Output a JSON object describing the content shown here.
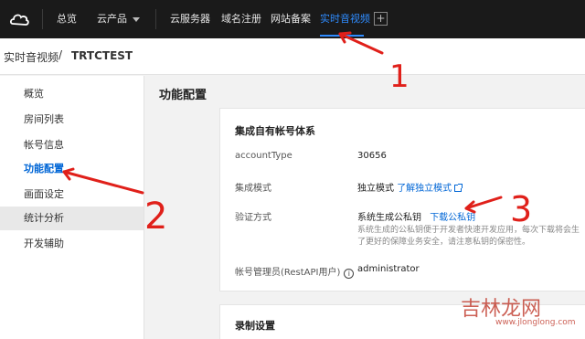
{
  "topbar": {
    "nav": [
      "总览",
      "云产品"
    ],
    "services": [
      "云服务器",
      "域名注册",
      "网站备案",
      "实时音视频"
    ],
    "add_label": "+",
    "active_color": "#2f8cff"
  },
  "breadcrumb": {
    "parent": "实时音视频",
    "separator": "/",
    "current": "TRTCTEST"
  },
  "sidebar": {
    "items": [
      "概览",
      "房间列表",
      "帐号信息",
      "功能配置",
      "画面设定",
      "统计分析",
      "开发辅助"
    ],
    "current_index": 3,
    "hover_index": 5
  },
  "main": {
    "title": "功能配置",
    "card": {
      "title": "集成自有帐号体系",
      "rows": {
        "account_type_label": "accountType",
        "account_type_value": "30656",
        "mode_label": "集成模式",
        "mode_value": "独立模式",
        "mode_link": "了解独立模式",
        "verify_label": "验证方式",
        "verify_value": "系统生成公私钥",
        "verify_link": "下载公私钥",
        "desc_line1": "系统生成的公私钥便于开发者快速开发应用，每次下载将会生",
        "desc_line2": "了更好的保障业务安全，请注意私钥的保密性。",
        "admin_label": "帐号管理员(RestAPI用户)",
        "admin_icon": "info-icon",
        "admin_value": "administrator"
      }
    },
    "card2_title": "录制设置"
  },
  "annotations": {
    "numbers": [
      "1",
      "2",
      "3"
    ],
    "color": "#e0201a"
  },
  "watermark": {
    "text": "吉林龙网",
    "url": "www.jlonglong.com"
  }
}
